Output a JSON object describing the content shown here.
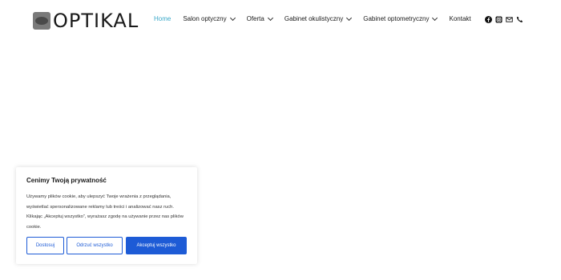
{
  "header": {
    "logo_text": "OPTIKAL",
    "nav": [
      {
        "label": "Home",
        "dropdown": false,
        "active": true
      },
      {
        "label": "Salon optyczny",
        "dropdown": true,
        "active": false
      },
      {
        "label": "Oferta",
        "dropdown": true,
        "active": false
      },
      {
        "label": "Gabinet okulistyczny",
        "dropdown": true,
        "active": false
      },
      {
        "label": "Gabinet optometryczny",
        "dropdown": true,
        "active": false
      },
      {
        "label": "Kontakt",
        "dropdown": false,
        "active": false
      }
    ],
    "social_icons": [
      "facebook-icon",
      "instagram-icon",
      "mail-icon",
      "phone-icon"
    ],
    "active_color": "#3aa8c8"
  },
  "cookie": {
    "title": "Cenimy Twoją prywatność",
    "text": "Używamy plików cookie, aby ulepszyć Twoje wrażenia z przeglądania, wyświetlać spersonalizowane reklamy lub treści i analizować nasz ruch. Klikając „Akceptuj wszystko”, wyrażasz zgodę na używanie przez nas plików cookie.",
    "customize_label": "Dostosuj",
    "reject_label": "Odrzuć wszystko",
    "accept_label": "Akceptuj wszystko",
    "accent_color": "#1d5bd6"
  }
}
